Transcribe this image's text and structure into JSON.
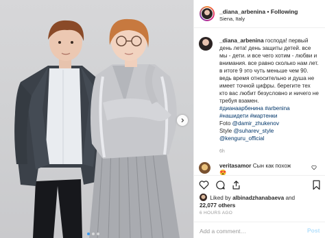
{
  "header": {
    "username": "_diana_arbenina",
    "separator": "•",
    "follow_label": "Following",
    "location": "Siena, Italy"
  },
  "caption": {
    "username": "_diana_arbenina",
    "text": "господа! первый день лета! день защиты детей. все мы - дети. и все чего хотим - любви и внимания. все равно сколько нам лет. в итоге 9 это чуть меньше чем 90. ведь время относительно и душа не имеет точной цифры. берегите тех кто вас любит безусловно и ничего не требуя взамен.",
    "hashtags": [
      "#дианаарбенина",
      "#arbenina",
      "#нашидети",
      "#мартенки"
    ],
    "photo_label": "Foto",
    "photo_credit": "@damir_zhukenov",
    "style_label": "Style",
    "style_credit_1": "@suharev_style",
    "style_credit_2": "@kenguru_official",
    "age": "6h"
  },
  "comment": {
    "username": "veritasamor",
    "text": "Сын как похож",
    "emoji": "😍"
  },
  "likes": {
    "prefix": "Liked by",
    "user": "albinadzhanabaeva",
    "connector": "and",
    "count": "22,077 others"
  },
  "timestamp": "6 HOURS AGO",
  "add_comment": {
    "placeholder": "Add a comment…",
    "post_label": "Post"
  },
  "carousel": {
    "slide_count": 3,
    "active_index": 0
  },
  "colors": {
    "link": "#003569",
    "accent": "#3897f0",
    "post_disabled": "#b2dffc",
    "muted": "#999999"
  },
  "icons": [
    "chevron-right-icon",
    "heart-icon",
    "comment-icon",
    "share-icon",
    "bookmark-icon"
  ]
}
